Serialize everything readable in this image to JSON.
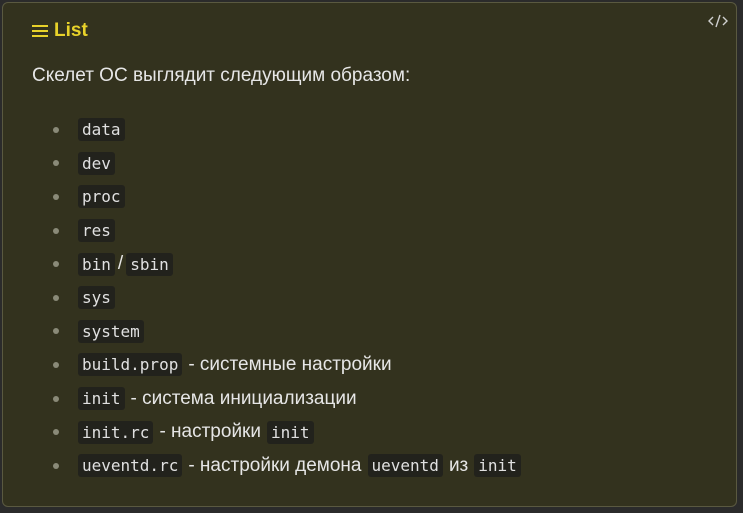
{
  "header": {
    "title": "List",
    "icon": "list-icon"
  },
  "toolbar": {
    "code_toggle_icon": "code-icon"
  },
  "intro": "Скелет ОС выглядит следующим образом:",
  "items": [
    {
      "code": "data"
    },
    {
      "code": "dev"
    },
    {
      "code": "proc"
    },
    {
      "code": "res"
    },
    {
      "code": "bin",
      "sep": "/",
      "code2": "sbin"
    },
    {
      "code": "sys"
    },
    {
      "code": "system"
    },
    {
      "code": "build.prop",
      "text": "- системные настройки"
    },
    {
      "code": "init",
      "text": "- система инициализации"
    },
    {
      "code": "init.rc",
      "text": "- настройки",
      "code2": "init"
    },
    {
      "code": "ueventd.rc",
      "text": "- настройки демона",
      "code2": "ueventd",
      "text2": "из",
      "code3": "init"
    }
  ],
  "colors": {
    "accent": "#e8d22a",
    "panel_bg": "#33321e",
    "code_bg": "#22221c",
    "text": "#e6e6e6"
  }
}
